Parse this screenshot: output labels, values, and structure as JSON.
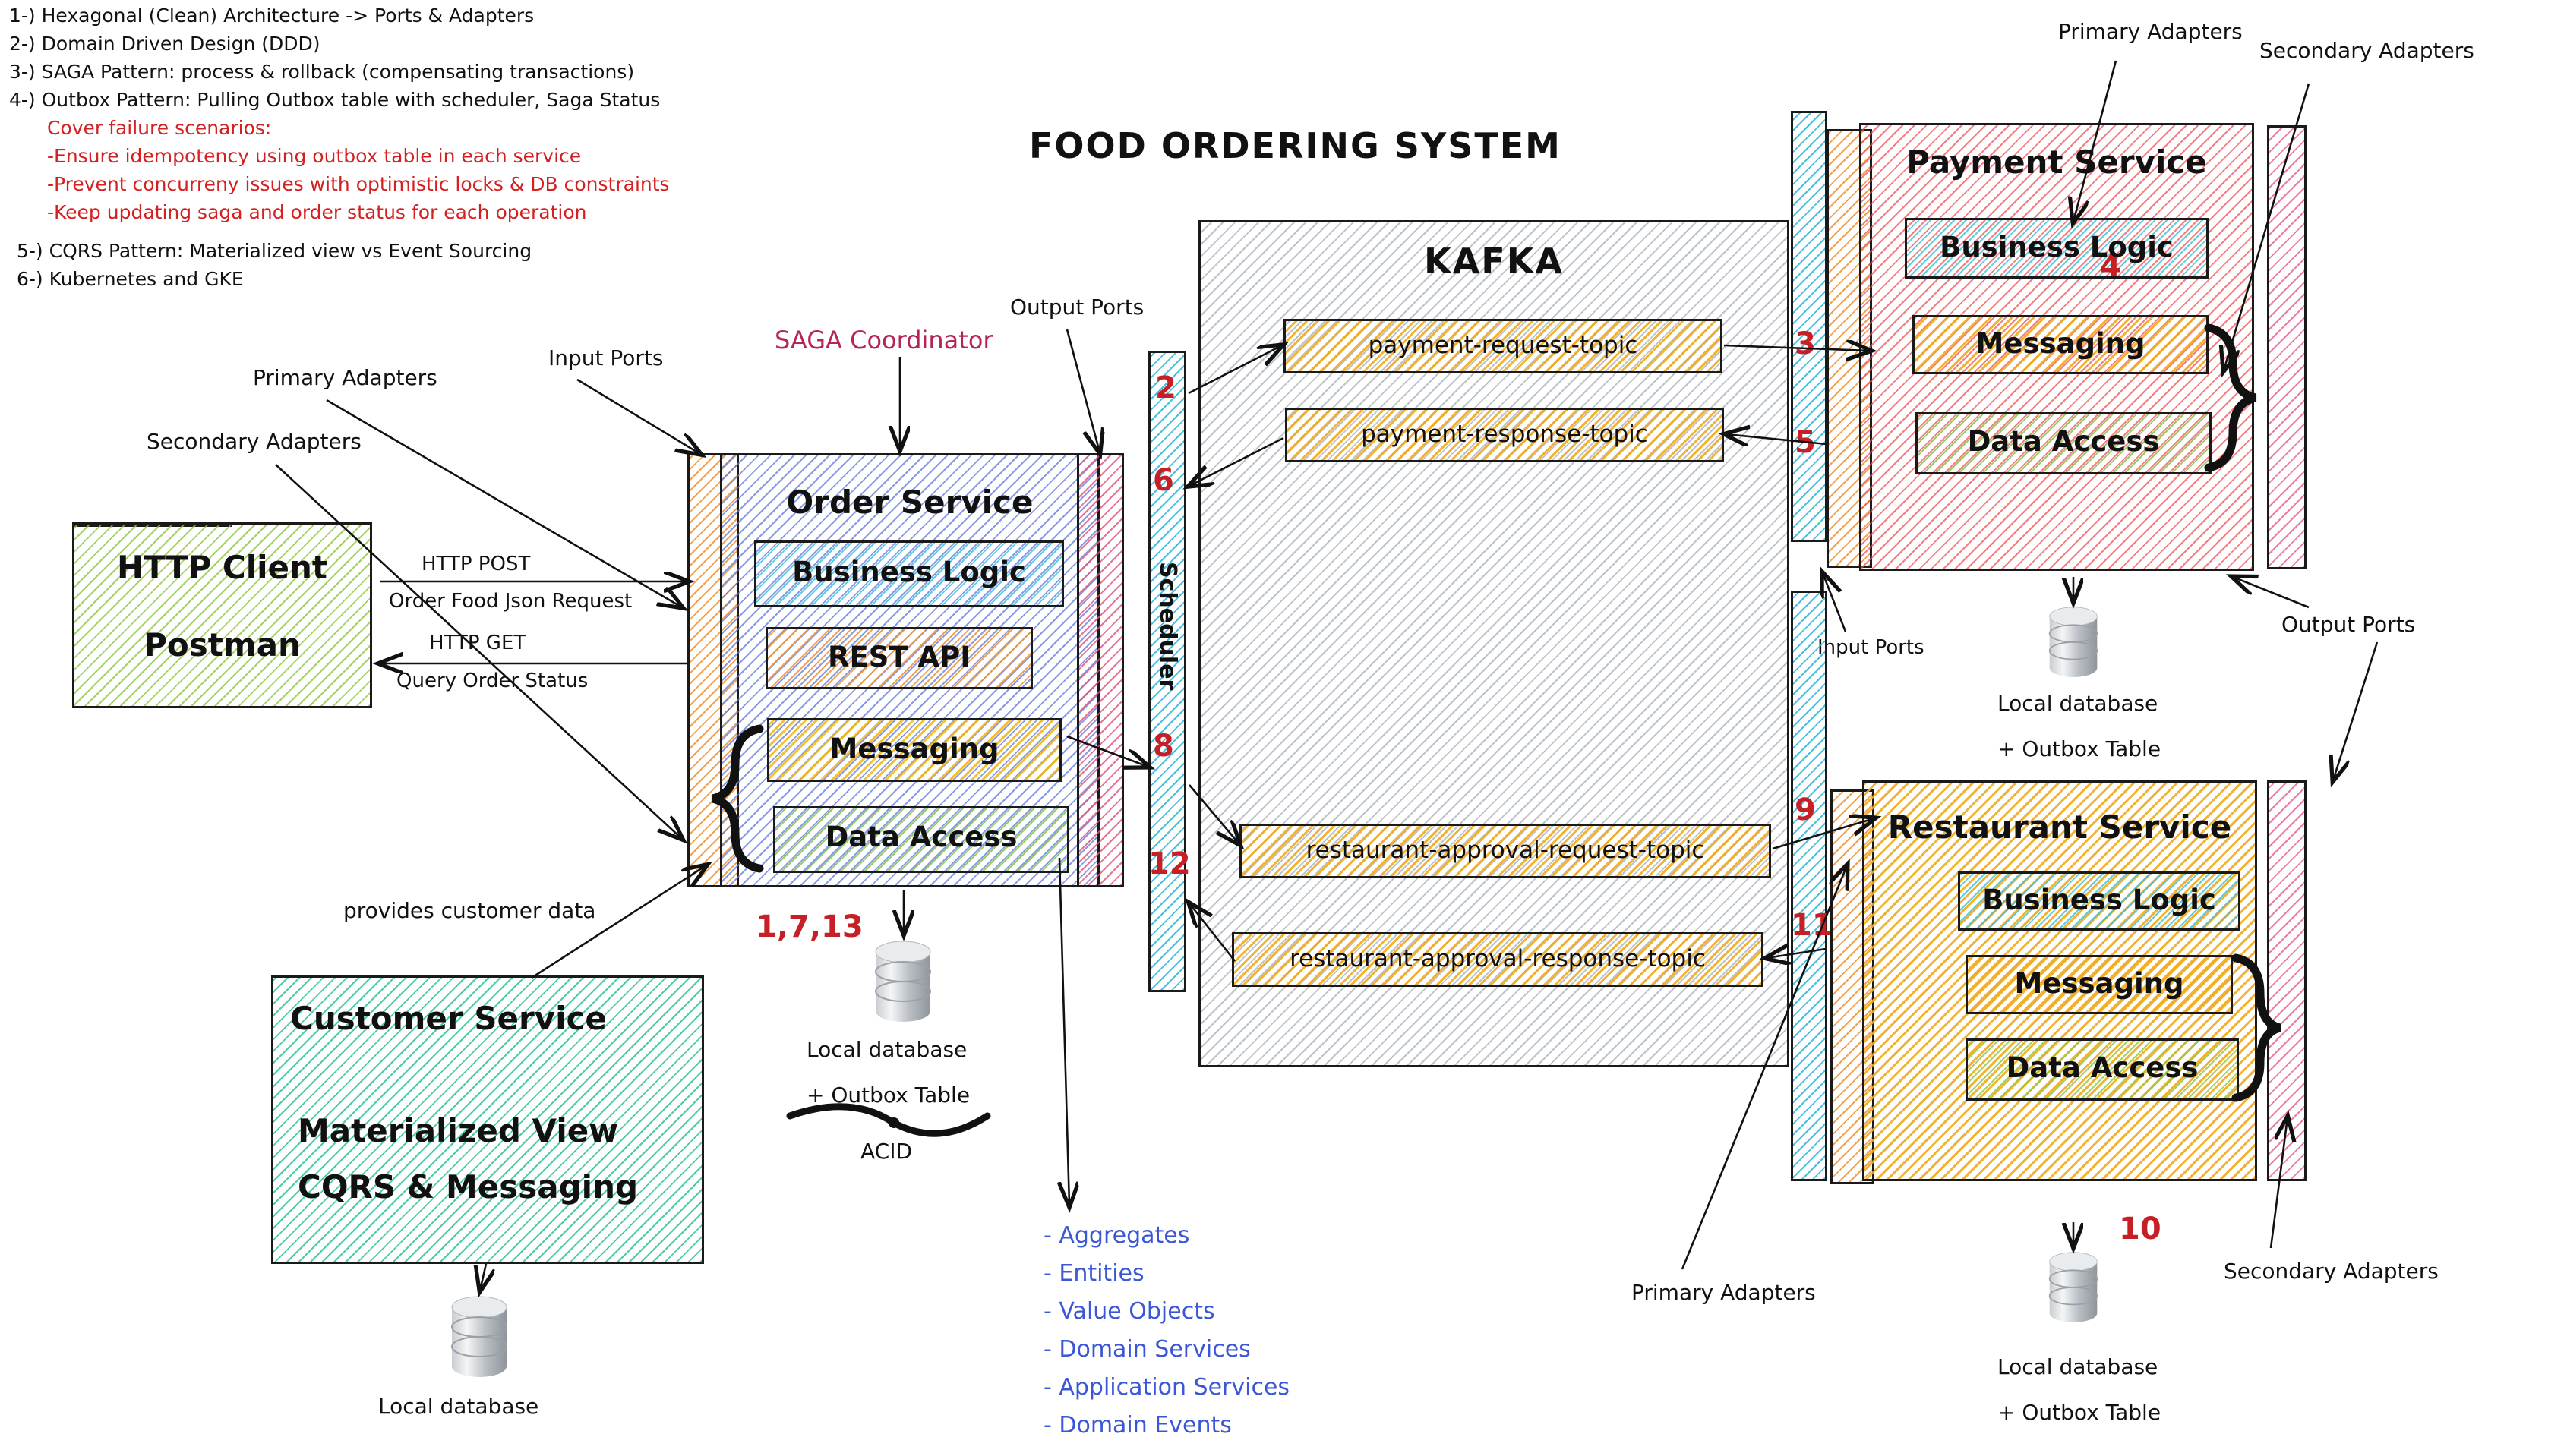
{
  "title": "FOOD ORDERING SYSTEM",
  "legend": {
    "items": [
      "1-) Hexagonal (Clean) Architecture -> Ports & Adapters",
      "2-) Domain Driven Design (DDD)",
      "3-) SAGA Pattern: process & rollback (compensating transactions)",
      "4-) Outbox Pattern: Pulling Outbox table with scheduler, Saga Status"
    ],
    "red_items": [
      "Cover failure scenarios:",
      "-Ensure idempotency using outbox table in each service",
      "-Prevent concurreny issues with optimistic locks & DB constraints",
      "-Keep updating saga and order status for each operation"
    ],
    "items_tail": [
      "5-) CQRS Pattern: Materialized view vs Event Sourcing",
      "6-) Kubernetes and GKE"
    ]
  },
  "client": {
    "line1": "HTTP Client",
    "line2": "Postman"
  },
  "customer_service": {
    "title": "Customer Service",
    "line2": "Materialized View",
    "line3": "CQRS & Messaging",
    "db_label": "Local database",
    "note": "provides customer data"
  },
  "order_service": {
    "title": "Order Service",
    "components": [
      "Business Logic",
      "REST API",
      "Messaging",
      "Data Access"
    ],
    "saga_label": "SAGA Coordinator",
    "input_ports": "Input Ports",
    "output_ports": "Output Ports",
    "primary_adapters": "Primary Adapters",
    "secondary_adapters": "Secondary Adapters",
    "db_number": "1,7,13",
    "db_label_1": "Local database",
    "db_label_2": "+ Outbox Table",
    "acid": "ACID"
  },
  "arrows": {
    "http_post": "HTTP POST",
    "order_food": "Order Food Json Request",
    "http_get": "HTTP GET",
    "query_status": "Query Order Status"
  },
  "scheduler": {
    "label": "Scheduler",
    "numbers": [
      "2",
      "6",
      "8",
      "12"
    ]
  },
  "kafka": {
    "title": "KAFKA",
    "topics": [
      "payment-request-topic",
      "payment-response-topic",
      "restaurant-approval-request-topic",
      "restaurant-approval-response-topic"
    ]
  },
  "payment_service": {
    "title": "Payment Service",
    "components": [
      "Business Logic",
      "Messaging",
      "Data Access"
    ],
    "scheduler_numbers": [
      "3",
      "5"
    ],
    "db_number": "4",
    "db_label_1": "Local database",
    "db_label_2": "+ Outbox Table",
    "primary_adapters": "Primary Adapters",
    "secondary_adapters": "Secondary Adapters",
    "input_ports": "Input Ports",
    "output_ports": "Output Ports"
  },
  "restaurant_service": {
    "title": "Restaurant Service",
    "components": [
      "Business Logic",
      "Messaging",
      "Data Access"
    ],
    "scheduler_numbers": [
      "9",
      "11"
    ],
    "db_number": "10",
    "db_label_1": "Local database",
    "db_label_2": "+ Outbox Table",
    "primary_adapters": "Primary Adapters",
    "secondary_adapters": "Secondary Adapters"
  },
  "ddd_list": [
    "- Aggregates",
    "- Entities",
    "- Value Objects",
    "- Domain Services",
    "- Application Services",
    "- Domain Events"
  ],
  "colors": {
    "red_number": "#c62026",
    "saga_pink": "#b5255a",
    "ddd_blue": "#3b57d6",
    "legend_red": "#d32020"
  }
}
